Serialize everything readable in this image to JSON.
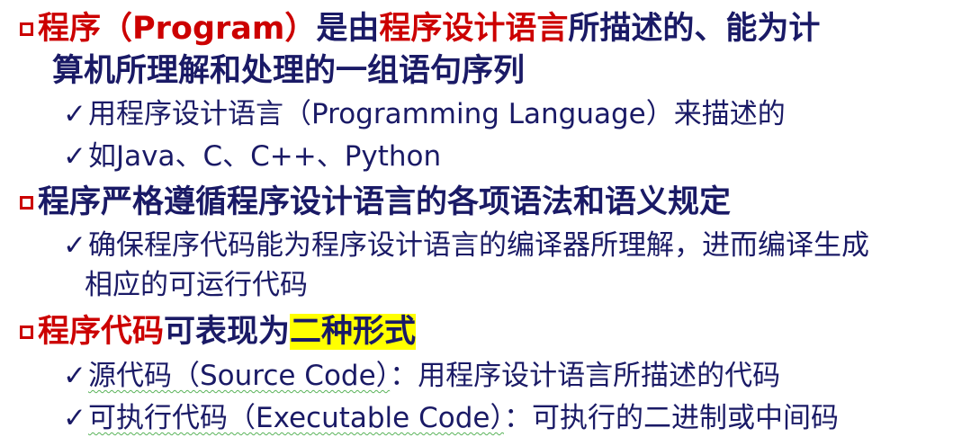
{
  "items": [
    {
      "type": "main",
      "segments": [
        {
          "text": "程序（Program）",
          "style": "red"
        },
        {
          "text": "是由",
          "style": "normal"
        },
        {
          "text": "程序设计语言",
          "style": "red"
        },
        {
          "text": "所描述的、能为计",
          "style": "normal"
        }
      ],
      "continuation": "算机所理解和处理的一组语句序列"
    },
    {
      "type": "sub",
      "text": "用程序设计语言（Programming Language）来描述的"
    },
    {
      "type": "sub",
      "text": "如Java、C、C++、Python"
    },
    {
      "type": "main",
      "segments": [
        {
          "text": "程序严格遵循程序设计语言的各项语法和语义规定",
          "style": "normal"
        }
      ]
    },
    {
      "type": "sub",
      "text": "确保程序代码能为程序设计语言的编译器所理解，进而编译生成",
      "continuation": "相应的可运行代码"
    },
    {
      "type": "main",
      "segments": [
        {
          "text": "程序代码",
          "style": "red"
        },
        {
          "text": "可表现为",
          "style": "normal"
        },
        {
          "text": "二种形式",
          "style": "highlight"
        }
      ]
    },
    {
      "type": "sub",
      "segments": [
        {
          "text": "源代码（Source Code）",
          "style": "wavy"
        },
        {
          "text": "：用程序设计语言所描述的代码",
          "style": "normal"
        }
      ]
    },
    {
      "type": "sub",
      "segments": [
        {
          "text": "可执行代码（Executable Code）",
          "style": "wavy"
        },
        {
          "text": "：可执行的二进制或中间码",
          "style": "normal"
        }
      ]
    }
  ],
  "glyphs": {
    "check": "✓"
  },
  "colors": {
    "text": "#1a1a66",
    "accent": "#cc0000",
    "highlight": "#ffff00",
    "squiggle": "#59b359"
  }
}
